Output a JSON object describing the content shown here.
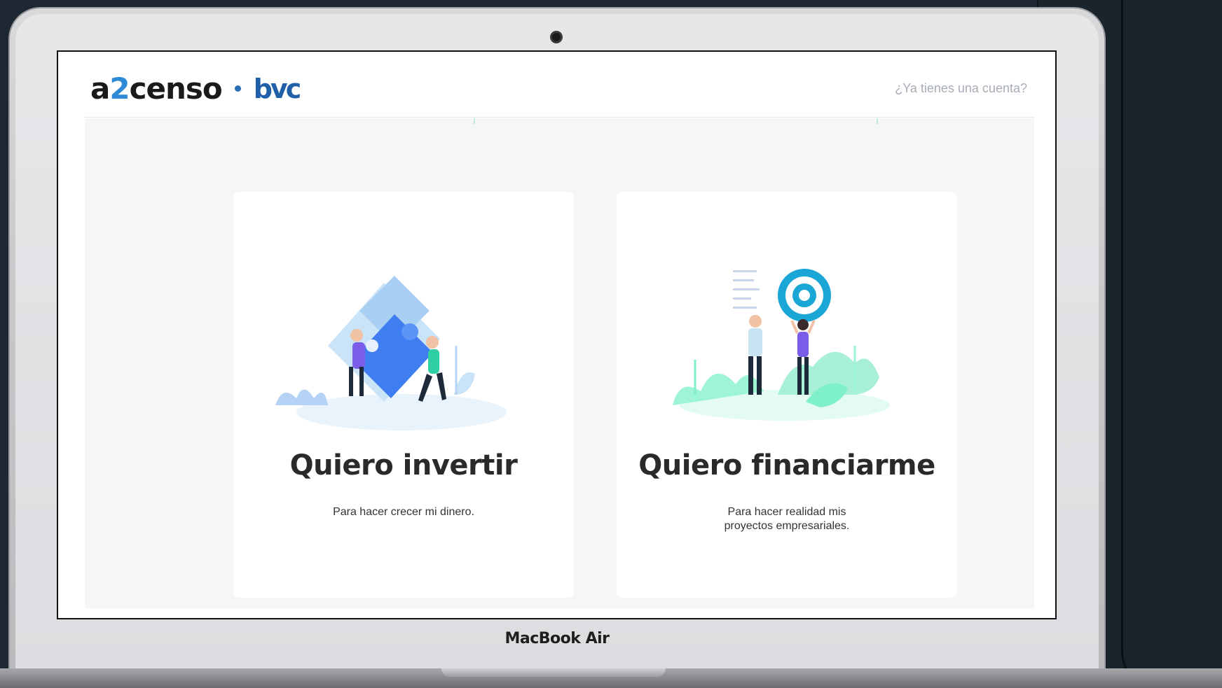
{
  "device": {
    "label": "MacBook Air"
  },
  "header": {
    "logo_text_pre": "a",
    "logo_text_two": "2",
    "logo_text_post": "censo",
    "logo_partner": "bvc",
    "account_link": "¿Ya tienes una cuenta?"
  },
  "cards": [
    {
      "title": "Quiero invertir",
      "subtitle_line1": "Para hacer crecer mi dinero.",
      "subtitle_line2": "",
      "illustration": "puzzle-illustration"
    },
    {
      "title": "Quiero financiarme",
      "subtitle_line1": "Para hacer realidad mis",
      "subtitle_line2": "proyectos empresariales.",
      "illustration": "target-illustration"
    }
  ],
  "colors": {
    "primary_blue": "#2e8ad6",
    "bvc_blue": "#1f5fa8",
    "puzzle_blue": "#3f7ef0",
    "mint": "#7ff0cc",
    "target_cyan": "#1aa7d6"
  }
}
